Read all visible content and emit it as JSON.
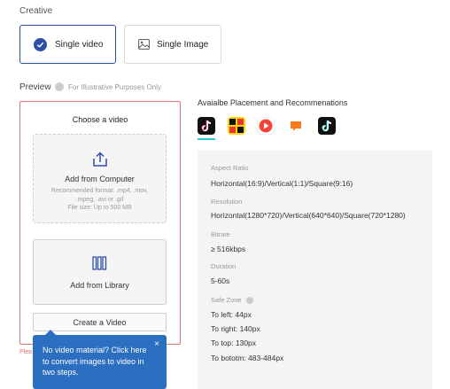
{
  "creative": {
    "section_label": "Creative",
    "options": [
      {
        "label": "Single video",
        "selected": true
      },
      {
        "label": "Single Image",
        "selected": false
      }
    ]
  },
  "preview": {
    "title": "Preview",
    "note": "For Illustrative Purposes Only"
  },
  "upload": {
    "heading": "Choose a video",
    "computer": {
      "label": "Add from Computer",
      "hint_lines": [
        "Recommended format: .mp4, .mov,",
        ".mpeg, .avi or .gif",
        "File size: Up to 500 MB"
      ]
    },
    "library": {
      "label": "Add from Library"
    },
    "create_label": "Create a Video",
    "error_fragment": "Plea"
  },
  "tooltip": {
    "text": "No video material? Click here to convert images to video in two steps.",
    "close": "×"
  },
  "placement": {
    "title": "Avaialbe Placement and Recommenations",
    "apps": [
      "tiktok-icon",
      "topbuzz-icon",
      "buzzvideo-icon",
      "news-republic-icon",
      "tiktok-icon"
    ]
  },
  "specs": {
    "aspect_ratio": {
      "label": "Aspect Ratio",
      "value": "Horizontal(16:9)/Vertical(1:1)/Square(9:16)"
    },
    "resolution": {
      "label": "Resolution",
      "value": "Horizontal(1280*720)/Vertical(640*640)/Square(720*1280)"
    },
    "bitrate": {
      "label": "Bitrate",
      "value": "≥ 516kbps"
    },
    "duration": {
      "label": "Duration",
      "value": "5-60s"
    },
    "safe_zone": {
      "label": "Safe Zone",
      "values": [
        "To left: 44px",
        "To right: 140px",
        "To top: 130px",
        "To bototm: 483-484px"
      ]
    }
  },
  "colors": {
    "accent": "#2c4fa8",
    "tooltip": "#2c6ec0",
    "error": "#e57373"
  }
}
